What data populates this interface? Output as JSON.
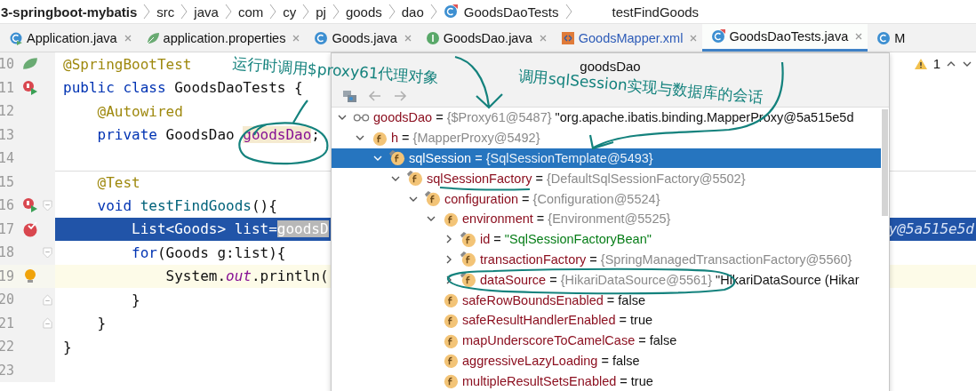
{
  "breadcrumb": {
    "items": [
      {
        "label": "3-springboot-mybatis",
        "kind": "project"
      },
      {
        "label": "src",
        "kind": "folder"
      },
      {
        "label": "java",
        "kind": "folder"
      },
      {
        "label": "com",
        "kind": "folder"
      },
      {
        "label": "cy",
        "kind": "folder"
      },
      {
        "label": "pj",
        "kind": "folder"
      },
      {
        "label": "goods",
        "kind": "folder"
      },
      {
        "label": "dao",
        "kind": "folder"
      },
      {
        "label": "GoodsDaoTests",
        "kind": "test-class"
      },
      {
        "label": "testFindGoods",
        "kind": "method"
      }
    ]
  },
  "tabs": [
    {
      "label": "Application.java",
      "kind": "spring-class",
      "selected": false,
      "modified": false
    },
    {
      "label": "application.properties",
      "kind": "properties",
      "selected": false,
      "modified": false
    },
    {
      "label": "Goods.java",
      "kind": "class",
      "selected": false,
      "modified": false
    },
    {
      "label": "GoodsDao.java",
      "kind": "interface",
      "selected": false,
      "modified": false
    },
    {
      "label": "GoodsMapper.xml",
      "kind": "xml",
      "selected": false,
      "modified": true
    },
    {
      "label": "GoodsDaoTests.java",
      "kind": "test-class",
      "selected": true,
      "modified": false
    },
    {
      "label": "M",
      "kind": "class",
      "selected": false,
      "modified": false
    }
  ],
  "inspections": {
    "warnings": "1"
  },
  "editor": {
    "lines": [
      {
        "number": "10",
        "gutter_icon": {
          "kind": "spring"
        },
        "execution": false,
        "caret": false,
        "segments": [
          {
            "text": "@SpringBootTest",
            "kind": "annotation"
          }
        ]
      },
      {
        "number": "11",
        "gutter_icon": {
          "kind": "run"
        },
        "execution": false,
        "caret": false,
        "segments": [
          {
            "text": "public class ",
            "kind": "keyword"
          },
          {
            "text": "GoodsDaoTests {",
            "kind": "plain"
          }
        ]
      },
      {
        "number": "12",
        "execution": false,
        "caret": false,
        "segments": [
          {
            "text": "    @Autowired",
            "kind": "annotation"
          }
        ]
      },
      {
        "number": "13",
        "execution": false,
        "caret": false,
        "segments": [
          {
            "text": "    private ",
            "kind": "keyword"
          },
          {
            "text": "GoodsDao ",
            "kind": "plain"
          },
          {
            "text": "goodsDao",
            "kind": "usage"
          },
          {
            "text": ";",
            "kind": "plain"
          }
        ]
      },
      {
        "number": "14",
        "execution": false,
        "caret": false
      },
      {
        "number": "15",
        "execution": false,
        "caret": false,
        "segments": [
          {
            "text": "    @Test",
            "kind": "annotation"
          }
        ]
      },
      {
        "number": "16",
        "gutter_icon": {
          "kind": "run"
        },
        "fold_marker": {
          "kind": "start"
        },
        "execution": false,
        "caret": false,
        "segments": [
          {
            "text": "    void ",
            "kind": "keyword"
          },
          {
            "text": "testFindGoods",
            "kind": "method"
          },
          {
            "text": "(){",
            "kind": "plain"
          }
        ]
      },
      {
        "number": "17",
        "gutter_icon": {
          "kind": "breakpoint"
        },
        "execution": true,
        "caret": false,
        "segments": [
          {
            "text": "        List<Goods> list=",
            "kind": "plain"
          },
          {
            "text": "goodsD",
            "kind": "selection"
          }
        ],
        "inline_value": "y@5a515e5d"
      },
      {
        "number": "18",
        "fold_marker": {
          "kind": "start"
        },
        "execution": false,
        "caret": false,
        "segments": [
          {
            "text": "        for",
            "kind": "keyword"
          },
          {
            "text": "(Goods g:list){",
            "kind": "plain"
          }
        ]
      },
      {
        "number": "19",
        "gutter_icon": {
          "kind": "bulb"
        },
        "execution": false,
        "caret": true,
        "segments": [
          {
            "text": "            System.",
            "kind": "plain"
          },
          {
            "text": "out",
            "kind": "static"
          },
          {
            "text": ".println(",
            "kind": "plain"
          }
        ]
      },
      {
        "number": "20",
        "fold_marker": {
          "kind": "end"
        },
        "execution": false,
        "caret": false,
        "segments": [
          {
            "text": "        }",
            "kind": "plain"
          }
        ]
      },
      {
        "number": "21",
        "fold_marker": {
          "kind": "end"
        },
        "execution": false,
        "caret": false,
        "segments": [
          {
            "text": "    }",
            "kind": "plain"
          }
        ]
      },
      {
        "number": "22",
        "execution": false,
        "caret": false,
        "segments": [
          {
            "text": "}",
            "kind": "plain"
          }
        ]
      },
      {
        "number": "23",
        "execution": false,
        "caret": false
      }
    ]
  },
  "debugger": {
    "title": "goodsDao",
    "tree": [
      {
        "kind": "watch",
        "segments": [
          {
            "text": "goodsDao",
            "kind": "name"
          },
          {
            "text": "=",
            "kind": "operator"
          },
          {
            "text": "{$Proxy61@5487}",
            "kind": "reference"
          },
          {
            "text": "\"org.apache.ibatis.binding.MapperProxy@5a515e5d",
            "kind": "description"
          }
        ],
        "expanded": true,
        "selected": false,
        "children": [
          {
            "kind": "field",
            "final": false,
            "segments": [
              {
                "text": "h",
                "kind": "name"
              },
              {
                "text": "=",
                "kind": "operator"
              },
              {
                "text": "{MapperProxy@5492}",
                "kind": "reference"
              }
            ],
            "expanded": true,
            "selected": false,
            "children": [
              {
                "kind": "field",
                "final": true,
                "segments": [
                  {
                    "text": "sqlSession",
                    "kind": "name"
                  },
                  {
                    "text": "=",
                    "kind": "operator"
                  },
                  {
                    "text": "{SqlSessionTemplate@5493}",
                    "kind": "reference"
                  }
                ],
                "expanded": true,
                "selected": true,
                "children": [
                  {
                    "kind": "field",
                    "final": true,
                    "segments": [
                      {
                        "text": "sqlSessionFactory",
                        "kind": "name"
                      },
                      {
                        "text": "=",
                        "kind": "operator"
                      },
                      {
                        "text": "{DefaultSqlSessionFactory@5502}",
                        "kind": "reference"
                      }
                    ],
                    "expanded": true,
                    "selected": false,
                    "children": [
                      {
                        "kind": "field",
                        "final": true,
                        "segments": [
                          {
                            "text": "configuration",
                            "kind": "name"
                          },
                          {
                            "text": "=",
                            "kind": "operator"
                          },
                          {
                            "text": "{Configuration@5524}",
                            "kind": "reference"
                          }
                        ],
                        "expanded": true,
                        "selected": false,
                        "children": [
                          {
                            "kind": "field",
                            "final": false,
                            "segments": [
                              {
                                "text": "environment",
                                "kind": "name"
                              },
                              {
                                "text": "=",
                                "kind": "operator"
                              },
                              {
                                "text": "{Environment@5525}",
                                "kind": "reference"
                              }
                            ],
                            "expanded": true,
                            "selected": false,
                            "children": [
                              {
                                "kind": "field",
                                "final": true,
                                "segments": [
                                  {
                                    "text": "id",
                                    "kind": "name"
                                  },
                                  {
                                    "text": "=",
                                    "kind": "operator"
                                  },
                                  {
                                    "text": "\"SqlSessionFactoryBean\"",
                                    "kind": "string"
                                  }
                                ],
                                "expanded": false,
                                "selected": false
                              },
                              {
                                "kind": "field",
                                "final": true,
                                "segments": [
                                  {
                                    "text": "transactionFactory",
                                    "kind": "name"
                                  },
                                  {
                                    "text": "=",
                                    "kind": "operator"
                                  },
                                  {
                                    "text": "{SpringManagedTransactionFactory@5560}",
                                    "kind": "reference"
                                  }
                                ],
                                "expanded": false,
                                "selected": false
                              },
                              {
                                "kind": "field",
                                "final": true,
                                "segments": [
                                  {
                                    "text": "dataSource",
                                    "kind": "name"
                                  },
                                  {
                                    "text": "=",
                                    "kind": "operator"
                                  },
                                  {
                                    "text": "{HikariDataSource@5561}",
                                    "kind": "reference"
                                  },
                                  {
                                    "text": "\"HikariDataSource (Hikar",
                                    "kind": "description"
                                  }
                                ],
                                "expanded": false,
                                "selected": false
                              }
                            ]
                          },
                          {
                            "kind": "field",
                            "final": false,
                            "segments": [
                              {
                                "text": "safeRowBoundsEnabled",
                                "kind": "name"
                              },
                              {
                                "text": "=",
                                "kind": "operator"
                              },
                              {
                                "text": "false",
                                "kind": "literal"
                              }
                            ],
                            "selected": false
                          },
                          {
                            "kind": "field",
                            "final": false,
                            "segments": [
                              {
                                "text": "safeResultHandlerEnabled",
                                "kind": "name"
                              },
                              {
                                "text": "=",
                                "kind": "operator"
                              },
                              {
                                "text": "true",
                                "kind": "literal"
                              }
                            ],
                            "selected": false
                          },
                          {
                            "kind": "field",
                            "final": false,
                            "segments": [
                              {
                                "text": "mapUnderscoreToCamelCase",
                                "kind": "name"
                              },
                              {
                                "text": "=",
                                "kind": "operator"
                              },
                              {
                                "text": "false",
                                "kind": "literal"
                              }
                            ],
                            "selected": false
                          },
                          {
                            "kind": "field",
                            "final": false,
                            "segments": [
                              {
                                "text": "aggressiveLazyLoading",
                                "kind": "name"
                              },
                              {
                                "text": "=",
                                "kind": "operator"
                              },
                              {
                                "text": "false",
                                "kind": "literal"
                              }
                            ],
                            "selected": false
                          },
                          {
                            "kind": "field",
                            "final": false,
                            "segments": [
                              {
                                "text": "multipleResultSetsEnabled",
                                "kind": "name"
                              },
                              {
                                "text": "=",
                                "kind": "operator"
                              },
                              {
                                "text": "true",
                                "kind": "literal"
                              }
                            ],
                            "selected": false
                          }
                        ]
                      }
                    ]
                  }
                ]
              }
            ]
          }
        ]
      }
    ]
  },
  "annotations": [
    {
      "text": "运行时调用$proxy61代理对象",
      "kind": "note-left"
    },
    {
      "text": "调用sqlSession实现与数据库的会话",
      "kind": "note-right"
    }
  ]
}
